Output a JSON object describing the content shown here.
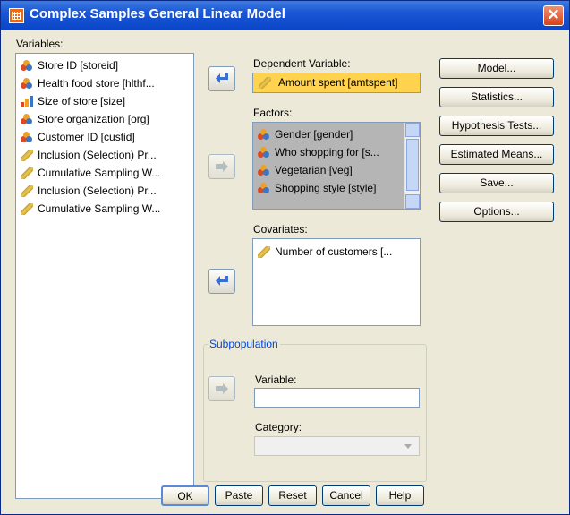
{
  "window": {
    "title": "Complex Samples General Linear Model"
  },
  "labels": {
    "variables": "Variables:",
    "dependent": "Dependent Variable:",
    "factors": "Factors:",
    "covariates": "Covariates:",
    "subpopulation": "Subpopulation",
    "variable": "Variable:",
    "category": "Category:"
  },
  "variables": [
    {
      "label": "Store ID [storeid]",
      "icon": "nominal"
    },
    {
      "label": "Health food store [hlthf...",
      "icon": "nominal"
    },
    {
      "label": "Size of store [size]",
      "icon": "ordinal"
    },
    {
      "label": "Store organization [org]",
      "icon": "nominal"
    },
    {
      "label": "Customer ID [custid]",
      "icon": "nominal"
    },
    {
      "label": "Inclusion (Selection) Pr...",
      "icon": "scale"
    },
    {
      "label": "Cumulative Sampling W...",
      "icon": "scale"
    },
    {
      "label": "Inclusion (Selection) Pr...",
      "icon": "scale"
    },
    {
      "label": "Cumulative Sampling W...",
      "icon": "scale"
    }
  ],
  "dependent": {
    "label": "Amount spent [amtspent]",
    "icon": "scale"
  },
  "factors": [
    {
      "label": "Gender [gender]",
      "icon": "nominal"
    },
    {
      "label": "Who shopping for [s...",
      "icon": "nominal"
    },
    {
      "label": "Vegetarian [veg]",
      "icon": "nominal"
    },
    {
      "label": "Shopping style [style]",
      "icon": "nominal"
    }
  ],
  "covariates": [
    {
      "label": "Number of customers [...",
      "icon": "scale"
    }
  ],
  "side_buttons": {
    "model": "Model...",
    "statistics": "Statistics...",
    "hypothesis": "Hypothesis Tests...",
    "means": "Estimated Means...",
    "save": "Save...",
    "options": "Options..."
  },
  "bottom_buttons": {
    "ok": "OK",
    "paste": "Paste",
    "reset": "Reset",
    "cancel": "Cancel",
    "help": "Help"
  },
  "subpop": {
    "variable_value": "",
    "category_value": ""
  },
  "colors": {
    "title_bar": "#0a46c8",
    "dialog_bg": "#ece9d8",
    "dependent_bg": "#ffd34d",
    "factor_bg": "#b5b5b5",
    "group_label": "#0046d5"
  }
}
